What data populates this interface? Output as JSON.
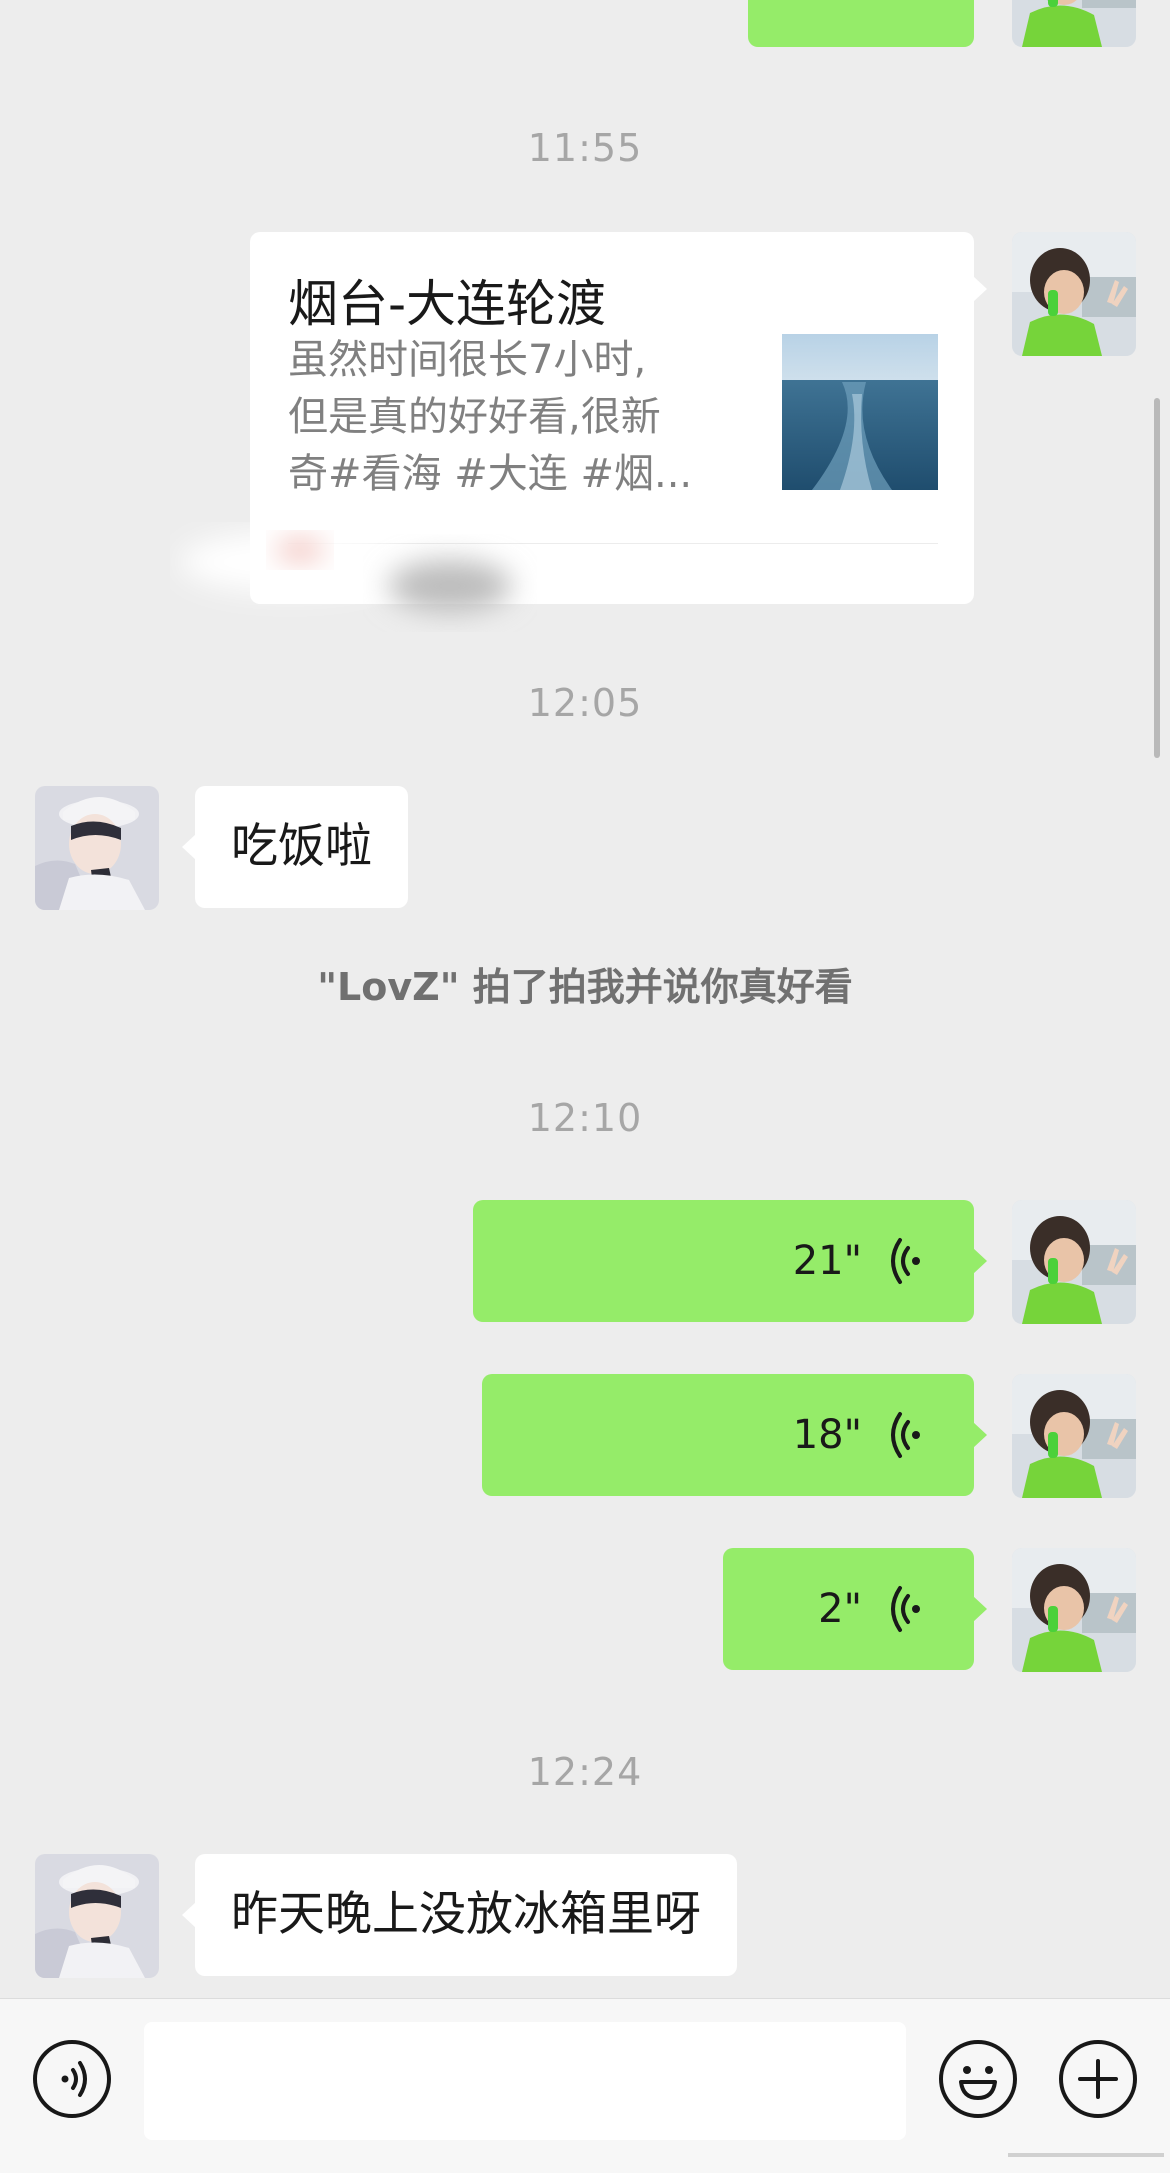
{
  "messages": {
    "top_partial": {
      "side": "right"
    },
    "ts1": "11:55",
    "card": {
      "title": "烟台-大连轮渡",
      "desc_line1": "虽然时间很长7小时,",
      "desc_line2": "但是真的好好看,很新",
      "desc_line3": "奇#看海 #大连 #烟..."
    },
    "ts2": "12:05",
    "msg1": "吃饭啦",
    "sys1": "\"LovZ\" 拍了拍我并说你真好看",
    "ts3": "12:10",
    "voice1": "21\"",
    "voice2": "18\"",
    "voice3": "2\"",
    "ts4": "12:24",
    "msg2": "昨天晚上没放冰箱里呀"
  },
  "input": {
    "value": "",
    "placeholder": ""
  },
  "icons": {
    "voice_toggle": "voice-mode-icon",
    "emoji": "emoji-icon",
    "plus": "plus-icon",
    "voice_wave": "voice-wave-icon"
  },
  "colors": {
    "background": "#ededed",
    "sent_bubble": "#95ec69",
    "received_bubble": "#ffffff",
    "timestamp": "#a6a6a6"
  }
}
